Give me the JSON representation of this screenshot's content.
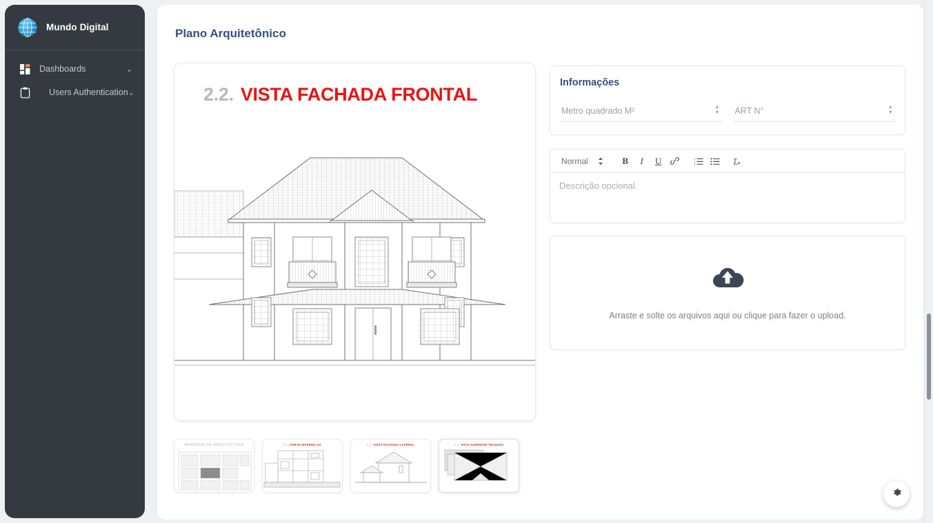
{
  "sidebar": {
    "brand": {
      "title": "Mundo Digital",
      "logo_icon": "globe-icon"
    },
    "items": [
      {
        "label": "Dashboards",
        "icon": "grid-dashboard-icon",
        "caret": "⌄"
      },
      {
        "label": "Users Authentication",
        "icon": "clipboard-icon",
        "caret": "⌄"
      }
    ]
  },
  "header": {
    "title": "Plano Arquitetônico"
  },
  "viewer": {
    "drawing_number": "2.2.",
    "drawing_name": "VISTA FACHADA FRONTAL",
    "accent_red": "#ee1111",
    "num_color": "#b9b9b9"
  },
  "thumbnails": [
    {
      "caption_plain": "PRANCHA DE ARQUITETURA",
      "num": "",
      "name": "",
      "selected": false
    },
    {
      "caption_plain": "",
      "num": "2.4.",
      "name": "CORTE INTERNO AA'",
      "selected": false
    },
    {
      "caption_plain": "",
      "num": "2.3.",
      "name": "VISTA FACHADA LATERAL",
      "selected": false
    },
    {
      "caption_plain": "",
      "num": "2.5.",
      "name": "VISTA SUPERIOR TELHADO",
      "selected": true
    }
  ],
  "info_panel": {
    "title": "Informações",
    "fields": [
      {
        "placeholder": "Metro quadrado M²",
        "value": ""
      },
      {
        "placeholder": "ART N°",
        "value": ""
      }
    ]
  },
  "editor": {
    "format_label": "Normal",
    "buttons": [
      {
        "name": "bold-icon",
        "glyph": "B"
      },
      {
        "name": "italic-icon",
        "glyph": "I"
      },
      {
        "name": "underline-icon",
        "glyph": "U"
      },
      {
        "name": "link-icon",
        "glyph": "🔗"
      },
      {
        "name": "ordered-list-icon",
        "glyph": ""
      },
      {
        "name": "bullet-list-icon",
        "glyph": ""
      },
      {
        "name": "clear-format-icon",
        "glyph": ""
      }
    ],
    "placeholder": "Descrição opcional.",
    "value": ""
  },
  "dropzone": {
    "icon": "cloud-upload-icon",
    "text": "Arraste e solte os arquivos aqui ou clique para fazer o upload."
  },
  "fab": {
    "icon": "gear-icon"
  },
  "colors": {
    "sidebar_bg": "#343a40",
    "page_bg": "#eef0f4",
    "title_blue": "#34517e",
    "accent_red": "#ee1111"
  }
}
